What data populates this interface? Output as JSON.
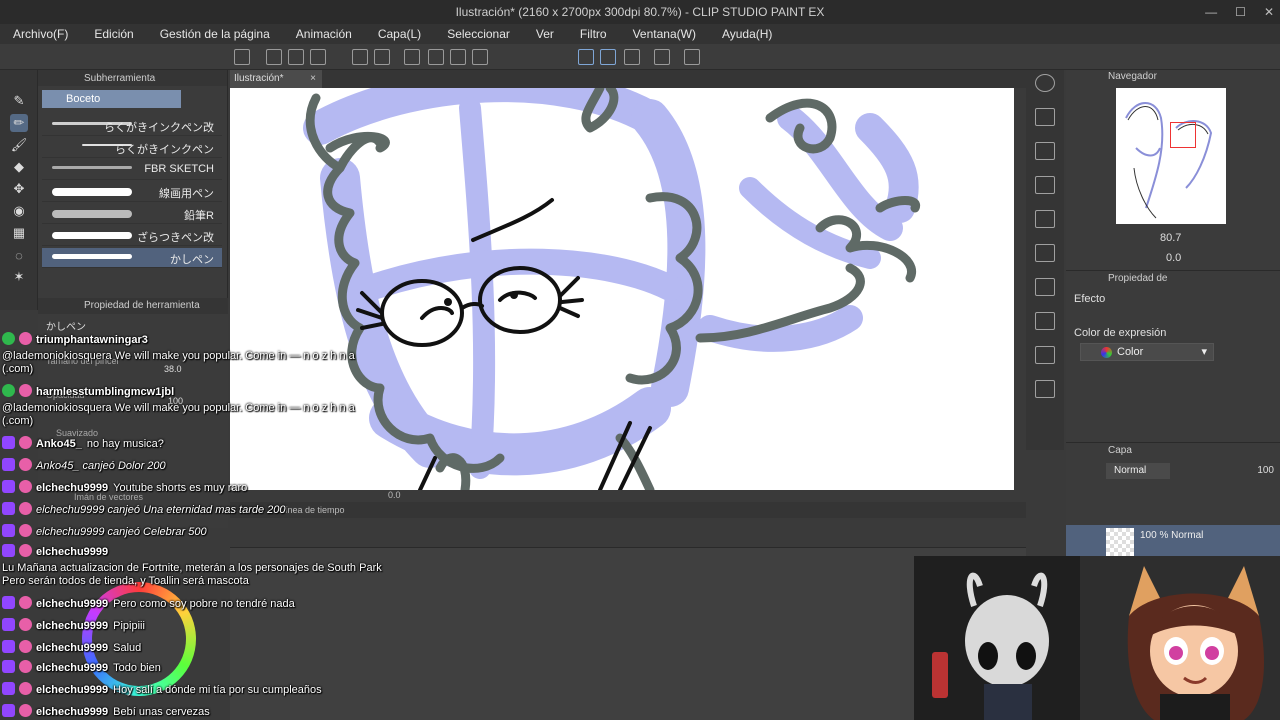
{
  "window": {
    "title": "Ilustración* (2160 x 2700px 300dpi 80.7%)  - CLIP STUDIO PAINT EX",
    "controls": [
      "—",
      "☐",
      "✕"
    ]
  },
  "menu": [
    "Archivo(F)",
    "Edición",
    "Gestión de la página",
    "Animación",
    "Capa(L)",
    "Seleccionar",
    "Ver",
    "Filtro",
    "Ventana(W)",
    "Ayuda(H)"
  ],
  "subtool": {
    "panel_title": "Subherramienta",
    "group": "Boceto",
    "brushes": [
      "らくがきインクペン改",
      "らくがきインクペン",
      "FBR SKETCH",
      "線画用ペン",
      "鉛筆R",
      "ざらつきペン改",
      "かしペン"
    ]
  },
  "toolprop": {
    "panel_title": "Propiedad de herramienta",
    "brush_name": "かしペン",
    "size_label": "Tamaño del pincel",
    "size_value": "38.0",
    "opacity_label": "Opacidad",
    "opacity_value": "100",
    "smoothing_label": "Suavizado",
    "vector_label": "Imán de vectores"
  },
  "canvas": {
    "tab": "Ilustración*",
    "zoom_readout": "80.7",
    "rotation_readout": "0.0"
  },
  "timeline": {
    "panel_title": "Línea de tiempo"
  },
  "navigator": {
    "panel_title": "Navegador",
    "zoom": "80.7",
    "rotation": "0.0"
  },
  "layer_property": {
    "panel_title": "Propiedad de",
    "effect_label": "Efecto",
    "expression_label": "Color de expresión",
    "expression_value": "Color"
  },
  "layers": {
    "panel_title": "Capa",
    "blend_mode": "Normal",
    "opacity": "100",
    "selected_layer": "100 % Normal"
  },
  "chat": [
    {
      "user": "triumphantawningar3",
      "badge": "green",
      "text": ""
    },
    {
      "user": "",
      "badge": "",
      "text": "@lademoniokiosquera We will make you popular. Come in — n o z h n a (.com)"
    },
    {
      "user": "harmlesstumblingmcw1jbl",
      "badge": "green",
      "text": ""
    },
    {
      "user": "",
      "badge": "",
      "text": "@lademoniokiosquera We will make you popular. Come in — n o z h n a (.com)"
    },
    {
      "user": "Anko45_",
      "badge": "purple",
      "text": "no hay musica?"
    },
    {
      "user": "",
      "badge": "purple",
      "text": "Anko45_ canjeó Dolor 200"
    },
    {
      "user": "elchechu9999",
      "badge": "purple",
      "text": "Youtube shorts es muy raro"
    },
    {
      "user": "",
      "badge": "purple",
      "text": "elchechu9999 canjeó Una eternidad mas tarde 200"
    },
    {
      "user": "",
      "badge": "purple",
      "text": "elchechu9999 canjeó Celebrar 500"
    },
    {
      "user": "elchechu9999",
      "badge": "purple",
      "text": ""
    },
    {
      "user": "",
      "badge": "",
      "text": "Lu Mañana actualizacion de Fortnite, meterán a los personajes de South Park Pero serán todos de tienda, y Toallin será mascota"
    },
    {
      "user": "elchechu9999",
      "badge": "purple",
      "text": "Pero como soy pobre no tendré nada"
    },
    {
      "user": "elchechu9999",
      "badge": "purple",
      "text": "Pipipiii"
    },
    {
      "user": "elchechu9999",
      "badge": "purple",
      "text": "Salud"
    },
    {
      "user": "elchechu9999",
      "badge": "purple",
      "text": "Todo bien"
    },
    {
      "user": "elchechu9999",
      "badge": "purple",
      "text": "Hoy salí a dónde mi tía por su cumpleaños"
    },
    {
      "user": "elchechu9999",
      "badge": "purple",
      "text": "Bebí unas cervezas"
    }
  ],
  "colors": {
    "accent_selected": "#51627d",
    "sketch_blue": "#a9adf0",
    "line_gray": "#5f6a66"
  }
}
